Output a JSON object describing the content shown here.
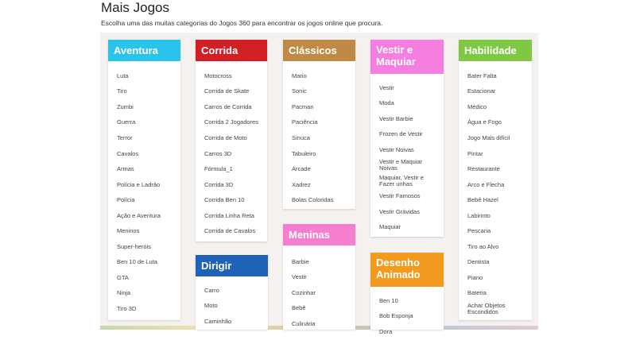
{
  "page": {
    "title": "Mais Jogos",
    "subtitle": "Escolha uma das muitas categorias do Jogos 360 para encontrar os jogos online que procura."
  },
  "categories": [
    {
      "title": "Aventura",
      "color": "#29c4ec",
      "items": [
        "Luta",
        "Tiro",
        "Zumbi",
        "Guerra",
        "Terror",
        "Cavalos",
        "Armas",
        "Polícia e Ladrão",
        "Polícia",
        "Ação e Aventura",
        "Meninos",
        "Super-heróis",
        "Ben 10 de Luta",
        "GTA",
        "Ninja",
        "Tiro 3D"
      ]
    },
    {
      "title": "Corrida",
      "color": "#d21f26",
      "items": [
        "Motocross",
        "Corrida de Skate",
        "Carros de Corrida",
        "Corrida 2 Jogadores",
        "Corrida de Moto",
        "Carros 3D",
        "Fórmula_1",
        "Corrida 3D",
        "Corrida Ben 10",
        "Corrida Linha Reta",
        "Corrida de Cavalos"
      ]
    },
    {
      "title": "Dirigir",
      "color": "#1f63b8",
      "items": [
        "Carro",
        "Moto",
        "Caminhão"
      ]
    },
    {
      "title": "Clássicos",
      "color": "#c08a45",
      "items": [
        "Mario",
        "Sonic",
        "Pacman",
        "Paciência",
        "Sinuca",
        "Tabuleiro",
        "Arcade",
        "Xadrez",
        "Bolas Coloridas"
      ]
    },
    {
      "title": "Meninas",
      "color": "#f57fce",
      "items": [
        "Barbie",
        "Vestir",
        "Cozinhar",
        "Bebê",
        "Culinária"
      ]
    },
    {
      "title": "Vestir e Maquiar",
      "color": "#f57fe0",
      "items": [
        "Vestir",
        "Moda",
        "Vestir Barbie",
        "Frozen de Vestir",
        "Vestir Noivas",
        "Vestir e Maquiar Noivas",
        "Maquiar, Vestir e Fazer unhas",
        "Vestir Famosos",
        "Vestir Grávidas",
        "Maquiar"
      ]
    },
    {
      "title": "Desenho Animado",
      "color": "#f29b1e",
      "items": [
        "Ben 10",
        "Bob Esponja",
        "Dora"
      ]
    },
    {
      "title": "Habilidade",
      "color": "#7fc843",
      "items": [
        "Bater Falta",
        "Estacionar",
        "Médico",
        "Água e Fogo",
        "Jogo Mais difícil",
        "Pintar",
        "Restaurante",
        "Arco e Flecha",
        "Bebê Hazel",
        "Labirinto",
        "Pescaria",
        "Tiro ao Alvo",
        "Dentista",
        "Piano",
        "Bateria",
        "Achar Objetos Escondidos"
      ]
    }
  ]
}
